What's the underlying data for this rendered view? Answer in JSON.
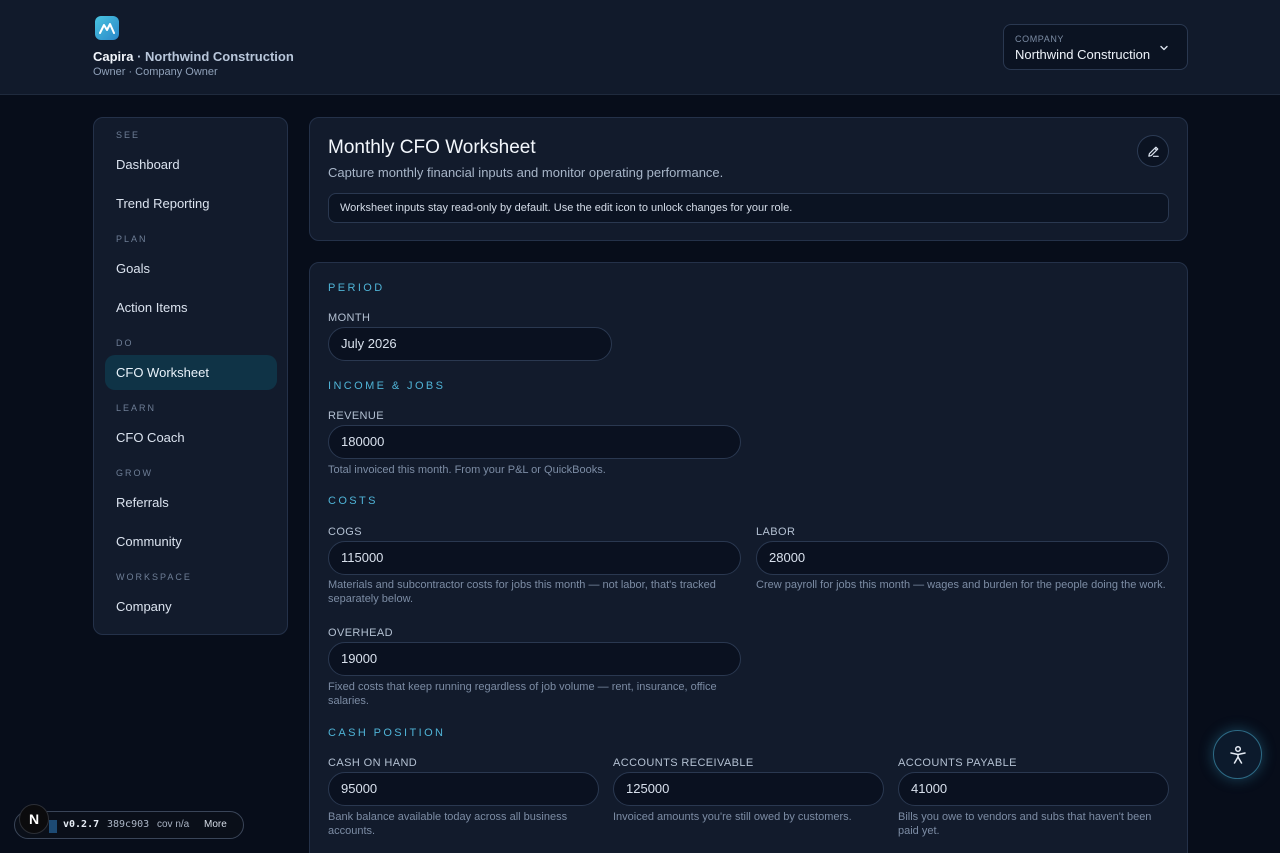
{
  "header": {
    "brand": "Capira",
    "separator": " · ",
    "company_name": "Northwind Construction",
    "role_line": "Owner · Company Owner",
    "company_select": {
      "label": "COMPANY",
      "value": "Northwind Construction"
    }
  },
  "sidebar": {
    "sections": [
      {
        "label": "SEE",
        "items": [
          "Dashboard",
          "Trend Reporting"
        ]
      },
      {
        "label": "PLAN",
        "items": [
          "Goals",
          "Action Items"
        ]
      },
      {
        "label": "DO",
        "items": [
          "CFO Worksheet"
        ]
      },
      {
        "label": "LEARN",
        "items": [
          "CFO Coach"
        ]
      },
      {
        "label": "GROW",
        "items": [
          "Referrals",
          "Community"
        ]
      },
      {
        "label": "WORKSPACE",
        "items": [
          "Company"
        ]
      }
    ],
    "active": "CFO Worksheet"
  },
  "worksheet": {
    "title": "Monthly CFO Worksheet",
    "subtitle": "Capture monthly financial inputs and monitor operating performance.",
    "notice": "Worksheet inputs stay read-only by default. Use the edit icon to unlock changes for your role."
  },
  "form": {
    "period": {
      "heading": "PERIOD",
      "month_label": "MONTH",
      "month_value": "July  2026"
    },
    "income": {
      "heading": "INCOME & JOBS",
      "revenue_label": "REVENUE",
      "revenue_value": "180000",
      "revenue_help": "Total invoiced this month. From your P&L or QuickBooks."
    },
    "costs": {
      "heading": "COSTS",
      "cogs_label": "COGS",
      "cogs_value": "115000",
      "cogs_help": "Materials and subcontractor costs for jobs this month — not labor, that's tracked separately below.",
      "labor_label": "LABOR",
      "labor_value": "28000",
      "labor_help": "Crew payroll for jobs this month — wages and burden for the people doing the work.",
      "overhead_label": "OVERHEAD",
      "overhead_value": "19000",
      "overhead_help": "Fixed costs that keep running regardless of job volume — rent, insurance, office salaries."
    },
    "cash": {
      "heading": "CASH POSITION",
      "cash_label": "CASH ON HAND",
      "cash_value": "95000",
      "cash_help": "Bank balance available today across all business accounts.",
      "ar_label": "ACCOUNTS RECEIVABLE",
      "ar_value": "125000",
      "ar_help": "Invoiced amounts you're still owed by customers.",
      "ap_label": "ACCOUNTS PAYABLE",
      "ap_value": "41000",
      "ap_help": "Bills you owe to vendors and subs that haven't been paid yet."
    }
  },
  "devbar": {
    "badge": "N",
    "version": "v0.2.7",
    "hash": "389c903",
    "coverage": "cov n/a",
    "more": "More"
  },
  "colors": {
    "accent": "#4fb3d6",
    "active_nav": "#0f3346",
    "background": "#070d1a",
    "card": "#121b2c"
  },
  "icons": {
    "logo": "capira-logo-icon",
    "select": "chevron-down-icon",
    "edit": "pencil-icon",
    "fab": "accessibility-icon"
  }
}
